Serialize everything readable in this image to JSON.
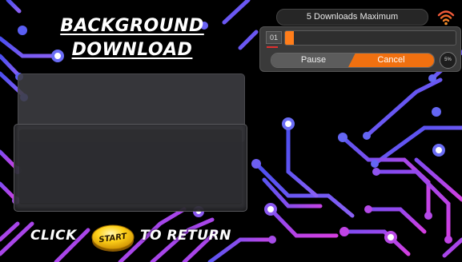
{
  "title": {
    "line1": "BACKGROUND",
    "line2": "DOWNLOAD"
  },
  "download_widget": {
    "max_label": "5 Downloads Maximum",
    "slot_number": "01",
    "progress": 0.05,
    "pause_label": "Pause",
    "cancel_label": "Cancel",
    "percent_label": "5%"
  },
  "prompt": {
    "click": "CLICK",
    "start_button": "START",
    "to_return": "TO RETURN"
  },
  "icons": {
    "wifi": "wifi-signal-icon"
  },
  "colors": {
    "accent": "#f07010",
    "circuit_blue": "#6a6cf5",
    "circuit_purple": "#c13de0",
    "background": "#000000"
  }
}
